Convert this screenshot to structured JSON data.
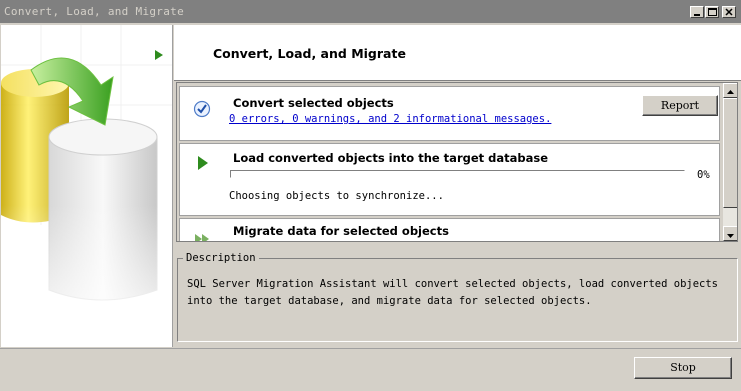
{
  "window": {
    "title": "Convert, Load, and Migrate"
  },
  "header": {
    "title": "Convert, Load, and Migrate"
  },
  "steps": [
    {
      "title": "Convert selected objects",
      "link": "0 errors, 0 warnings, and 2 informational messages.",
      "button": "Report",
      "icon": "check-circle-icon"
    },
    {
      "title": "Load converted objects into the target database",
      "progress_percent": 0,
      "percent_label": "0%",
      "status": "Choosing objects to synchronize...",
      "icon": "play-arrow-icon"
    },
    {
      "title": "Migrate data for selected objects",
      "icon": "double-arrow-icon"
    }
  ],
  "description": {
    "legend": "Description",
    "text": "SQL Server Migration Assistant will convert selected objects, load converted objects into the target database, and migrate data for selected objects."
  },
  "footer": {
    "stop_label": "Stop"
  },
  "colors": {
    "title_bar": "#808080",
    "link": "#0000cc",
    "accent_green": "#2e8b1e",
    "face": "#d4d0c8"
  }
}
